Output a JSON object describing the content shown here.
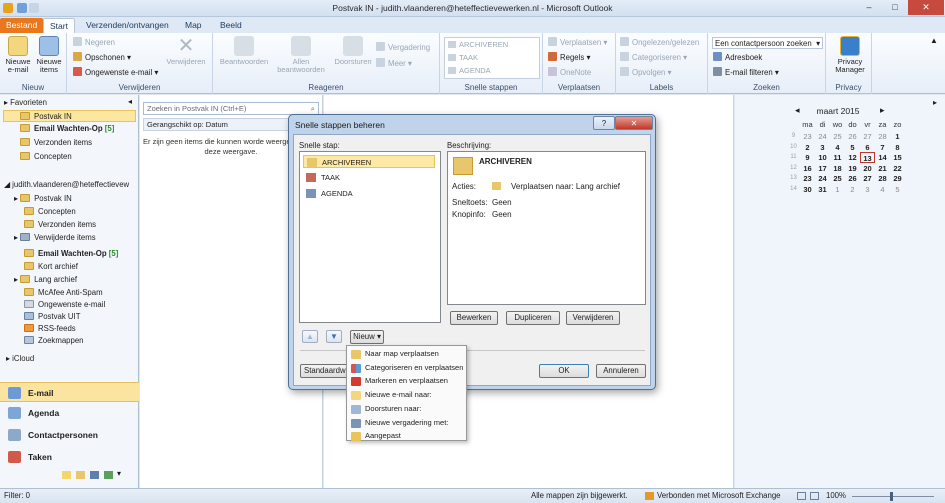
{
  "window": {
    "title": "Postvak IN - judith.vlaanderen@heteffectievewerken.nl - Microsoft Outlook",
    "min": "–",
    "max": "□",
    "close": "✕"
  },
  "tabs": [
    "Bestand",
    "Start",
    "Verzenden/ontvangen",
    "Map",
    "Beeld"
  ],
  "ribbon": {
    "nieuw": {
      "new_email": "Nieuwe e-mail",
      "new_items": "Nieuwe items",
      "label": "Nieuw"
    },
    "verwijderen": {
      "ignore": "Negeren",
      "cleanup": "Opschonen",
      "junk": "Ongewenste e-mail",
      "delete": "Verwijderen",
      "label": "Verwijderen"
    },
    "reageren": {
      "reply": "Beantwoorden",
      "reply_all": "Allen beantwoorden",
      "forward": "Doorsturen",
      "meeting": "Vergadering",
      "more": "Meer",
      "label": "Reageren"
    },
    "snelle_stappen": {
      "items": [
        "ARCHIVEREN",
        "TAAK",
        "AGENDA"
      ],
      "label": "Snelle stappen"
    },
    "verplaatsen": {
      "move": "Verplaatsen",
      "rules": "Regels",
      "onenote": "OneNote",
      "label": "Verplaatsen"
    },
    "labels": {
      "read": "Ongelezen/gelezen",
      "categorize": "Categoriseren",
      "followup": "Opvolgen",
      "label": "Labels"
    },
    "zoeken": {
      "find_contact": "Een contactpersoon zoeken",
      "address_book": "Adresboek",
      "filter": "E-mail filteren",
      "label": "Zoeken"
    },
    "privacy": {
      "manager": "Privacy Manager",
      "label": "Privacy"
    }
  },
  "nav": {
    "favorites_header": "Favorieten",
    "favorites": [
      {
        "label": "Postvak IN",
        "selected": true
      },
      {
        "label": "Email Wachten-Op",
        "count": "[5]",
        "bold": true
      },
      {
        "label": "Verzonden items"
      },
      {
        "label": "Concepten"
      }
    ],
    "account": "judith.vlaanderen@heteffectievew",
    "folders": [
      {
        "label": "Postvak IN"
      },
      {
        "label": "Concepten"
      },
      {
        "label": "Verzonden items"
      },
      {
        "label": "Verwijderde items"
      },
      {
        "label": "Email Wachten-Op",
        "count": "[5]",
        "bold": true
      },
      {
        "label": "Kort archief"
      },
      {
        "label": "Lang archief"
      },
      {
        "label": "McAfee Anti-Spam"
      },
      {
        "label": "Ongewenste e-mail"
      },
      {
        "label": "Postvak UIT"
      },
      {
        "label": "RSS-feeds"
      },
      {
        "label": "Zoekmappen"
      }
    ],
    "icloud": "iCloud",
    "bottom": [
      "E-mail",
      "Agenda",
      "Contactpersonen",
      "Taken"
    ]
  },
  "messages": {
    "search_placeholder": "Zoeken in Postvak IN (Ctrl+E)",
    "arrange": "Gerangschikt op: Datum",
    "empty": "Er zijn geen items die kunnen worde weergegeven in deze weergave."
  },
  "calendar": {
    "month": "maart 2015",
    "days": [
      "ma",
      "di",
      "wo",
      "do",
      "vr",
      "za",
      "zo"
    ],
    "weeks": [
      {
        "wk": "9",
        "d": [
          "23",
          "24",
          "25",
          "26",
          "27",
          "28",
          "1"
        ]
      },
      {
        "wk": "10",
        "d": [
          "2",
          "3",
          "4",
          "5",
          "6",
          "7",
          "8"
        ]
      },
      {
        "wk": "11",
        "d": [
          "9",
          "10",
          "11",
          "12",
          "13",
          "14",
          "15"
        ]
      },
      {
        "wk": "12",
        "d": [
          "16",
          "17",
          "18",
          "19",
          "20",
          "21",
          "22"
        ]
      },
      {
        "wk": "13",
        "d": [
          "23",
          "24",
          "25",
          "26",
          "27",
          "28",
          "29"
        ]
      },
      {
        "wk": "14",
        "d": [
          "30",
          "31",
          "1",
          "2",
          "3",
          "4",
          "5"
        ]
      }
    ],
    "today": "13"
  },
  "dialog": {
    "title": "Snelle stappen beheren",
    "help": "?",
    "steps_label": "Snelle stap:",
    "steps": [
      "ARCHIVEREN",
      "TAAK",
      "AGENDA"
    ],
    "desc_label": "Beschrijving:",
    "desc_title": "ARCHIVEREN",
    "actions_label": "Acties:",
    "actions_value": "Verplaatsen naar: Lang archief",
    "shortcut_label": "Sneltoets:",
    "shortcut_value": "Geen",
    "tooltip_label": "Knopinfo:",
    "tooltip_value": "Geen",
    "edit": "Bewerken",
    "duplicate": "Dupliceren",
    "delete": "Verwijderen",
    "up_arrow": "▲",
    "down_arrow": "▼",
    "new": "Nieuw",
    "defaults": "Standaardw",
    "ok": "OK",
    "cancel": "Annuleren"
  },
  "menu": [
    "Naar map verplaatsen",
    "Categoriseren en verplaatsen",
    "Markeren en verplaatsen",
    "Nieuwe e-mail naar:",
    "Doorsturen naar:",
    "Nieuwe vergadering met:",
    "Aangepast"
  ],
  "status": {
    "filter": "Filter: 0",
    "folders": "Alle mappen zijn bijgewerkt.",
    "connection": "Verbonden met Microsoft Exchange",
    "zoom": "100%"
  },
  "colors": {
    "accent": "#e8781b",
    "selection": "#fbe7a0",
    "ribbon": "#e7eef8"
  }
}
